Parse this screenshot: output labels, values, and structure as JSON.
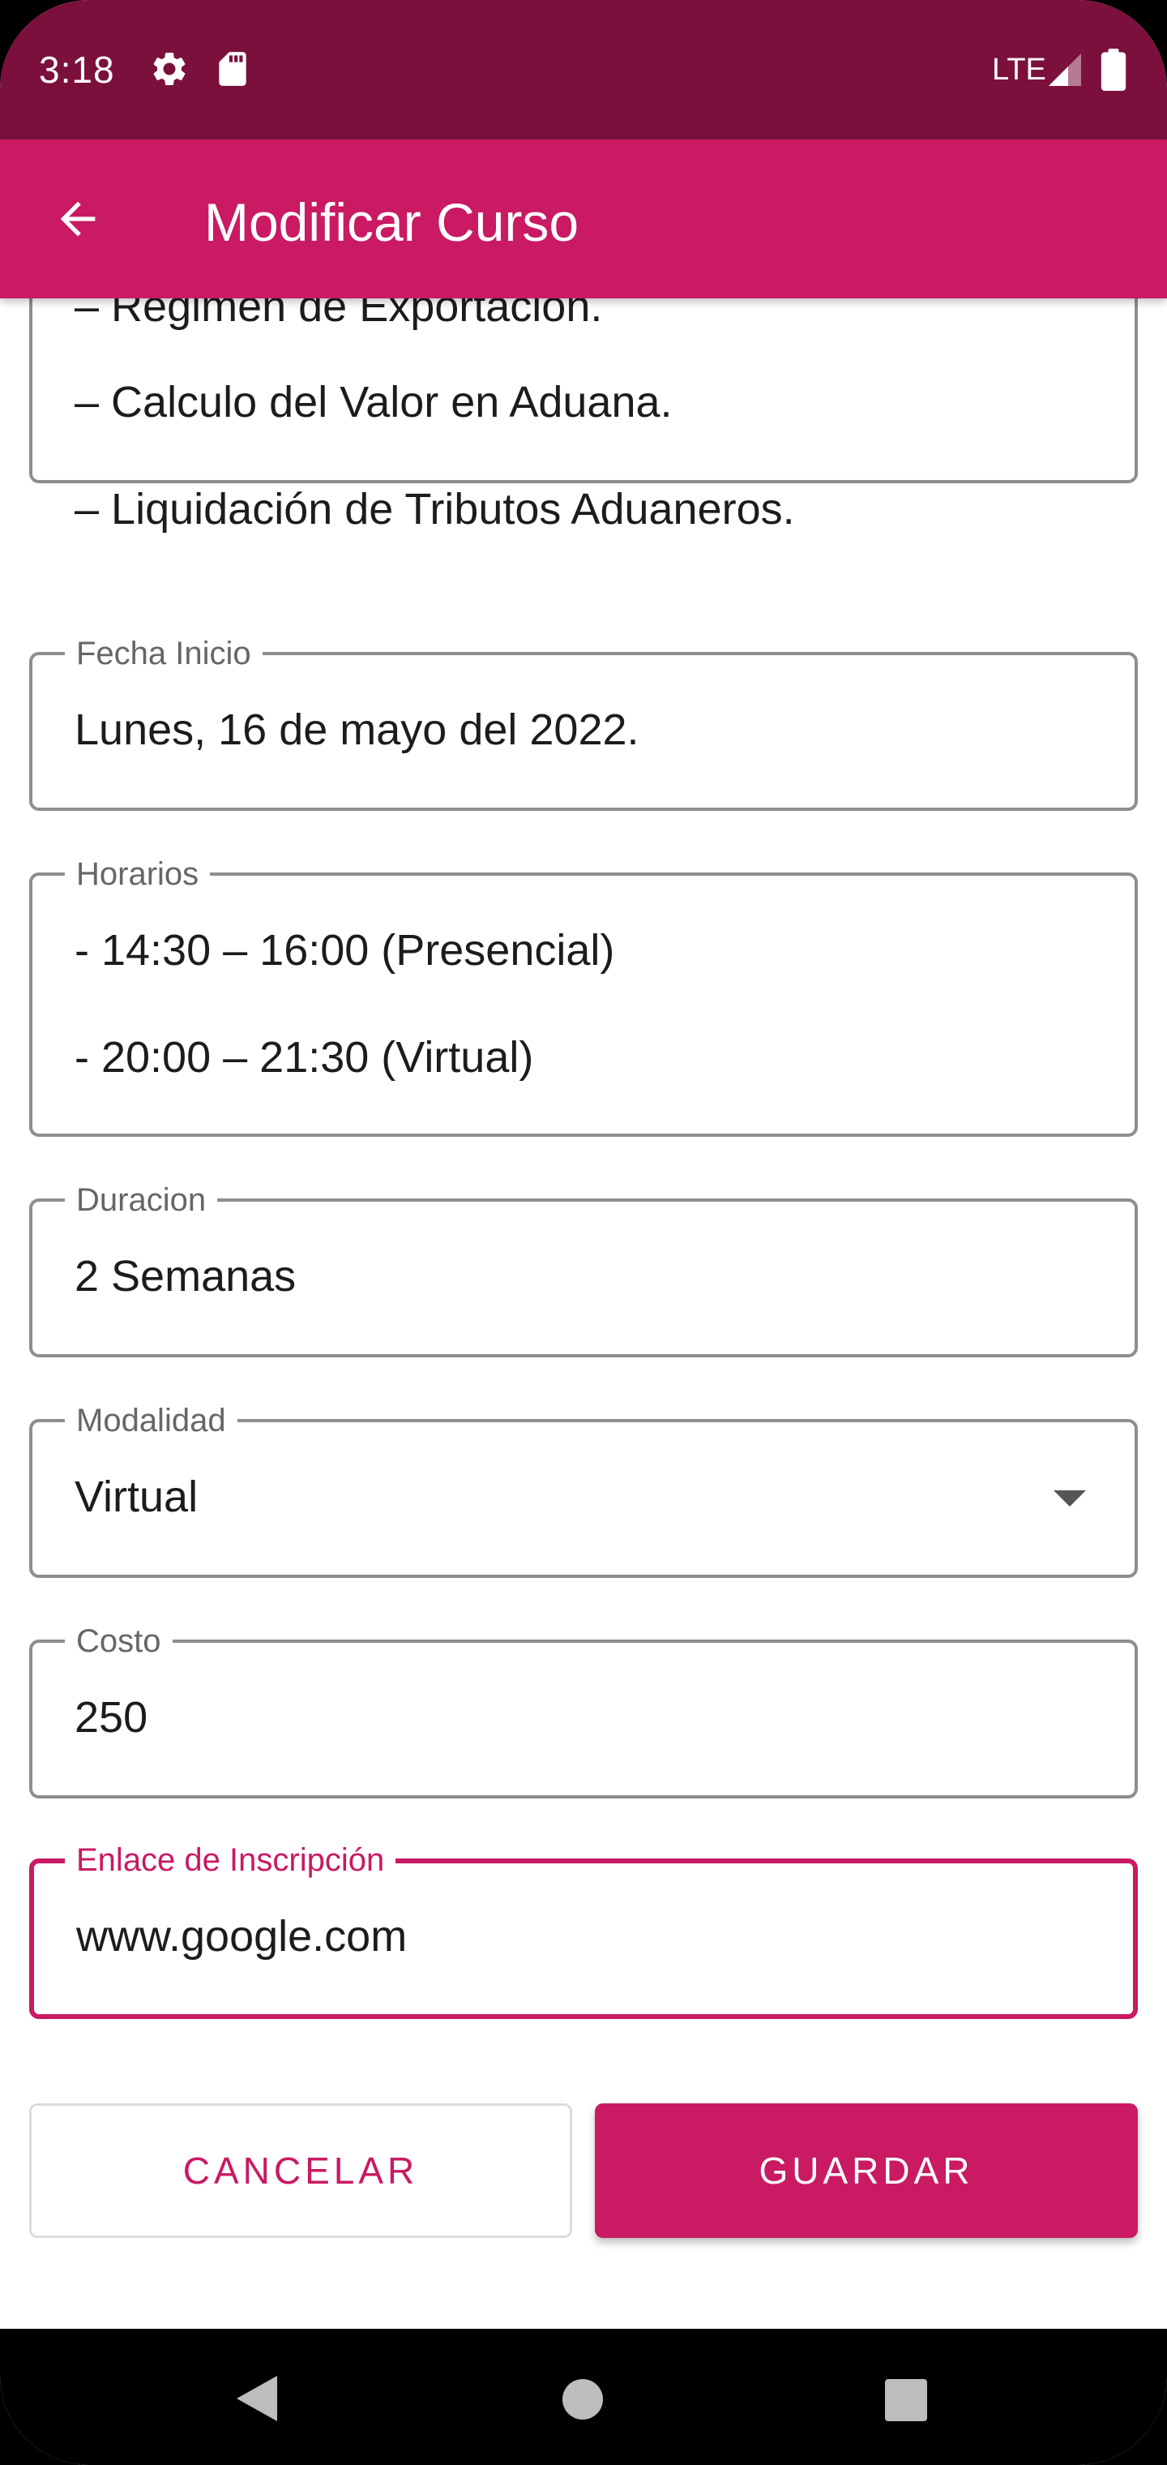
{
  "status_bar": {
    "time": "3:18",
    "network": "LTE",
    "icons": [
      "settings-icon",
      "sd-card-icon",
      "signal-icon",
      "battery-icon"
    ]
  },
  "app_bar": {
    "title": "Modificar Curso",
    "back_icon": "arrow-back-icon"
  },
  "form": {
    "description_lines": [
      "– Régimen de Exportación.",
      "– Calculo del Valor en Aduana.",
      "– Liquidación de Tributos Aduaneros."
    ],
    "fecha_inicio": {
      "label": "Fecha Inicio",
      "value": "Lunes, 16 de mayo del 2022."
    },
    "horarios": {
      "label": "Horarios",
      "lines": [
        "- 14:30 – 16:00 (Presencial)",
        "- 20:00 – 21:30 (Virtual)"
      ]
    },
    "duracion": {
      "label": "Duracion",
      "value": "2 Semanas"
    },
    "modalidad": {
      "label": "Modalidad",
      "value": "Virtual",
      "icon": "dropdown-arrow-icon"
    },
    "costo": {
      "label": "Costo",
      "value": "250"
    },
    "enlace": {
      "label": "Enlace de Inscripción",
      "value": "www.google.com"
    }
  },
  "actions": {
    "cancel_label": "CANCELAR",
    "save_label": "GUARDAR"
  },
  "colors": {
    "status_bar": "#7b103d",
    "primary": "#c91a63",
    "outline": "#8e8e8e",
    "label": "#666666"
  }
}
